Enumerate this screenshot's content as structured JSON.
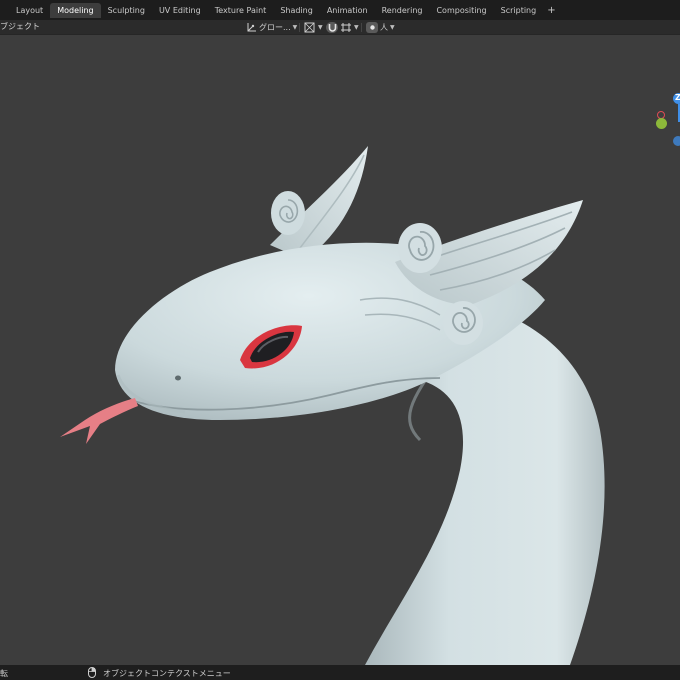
{
  "workspace_tabs": [
    "Layout",
    "Modeling",
    "Sculpting",
    "UV Editing",
    "Texture Paint",
    "Shading",
    "Animation",
    "Rendering",
    "Compositing",
    "Scripting"
  ],
  "add_tab": "+",
  "header": {
    "mode_label": "ブジェクト",
    "transform_orientation": "グロー...",
    "view_mode_label": "人"
  },
  "gizmo": {
    "z_label": "Z",
    "colors": {
      "x": "#e04b55",
      "y": "#8cb83a",
      "z": "#3f8fe8"
    }
  },
  "statusbar": {
    "left_label": "転",
    "context_menu_label": "オブジェクトコンテクストメニュー"
  },
  "colors": {
    "model": "#cfdcdf",
    "eye_rim": "#d93640",
    "tongue": "#e67f86",
    "background": "#3d3d3d"
  }
}
